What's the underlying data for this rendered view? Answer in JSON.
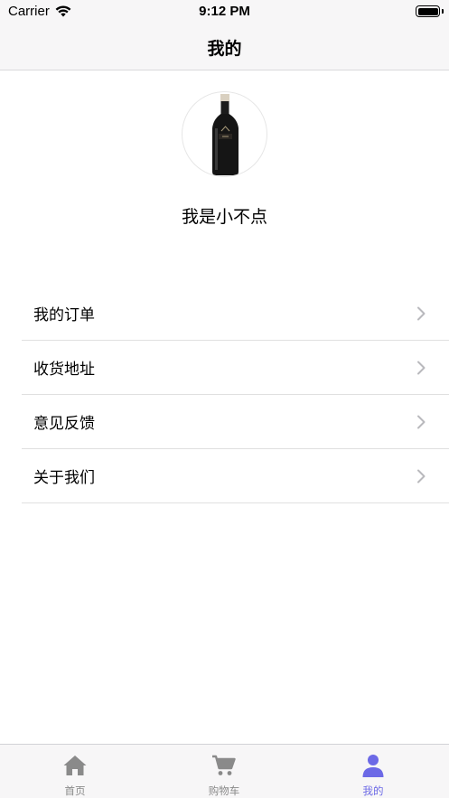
{
  "status_bar": {
    "carrier": "Carrier",
    "time": "9:12 PM"
  },
  "nav": {
    "title": "我的"
  },
  "profile": {
    "username": "我是小不点",
    "avatar_icon": "wine-bottle-avatar"
  },
  "menu": {
    "items": [
      {
        "label": "我的订单"
      },
      {
        "label": "收货地址"
      },
      {
        "label": "意见反馈"
      },
      {
        "label": "关于我们"
      }
    ]
  },
  "tab_bar": {
    "tabs": [
      {
        "label": "首页",
        "icon": "home-icon"
      },
      {
        "label": "购物车",
        "icon": "cart-icon"
      },
      {
        "label": "我的",
        "icon": "person-icon"
      }
    ],
    "active_index": 2
  },
  "colors": {
    "accent": "#6c69e6",
    "inactive_tab": "#8a8a8a",
    "bar_bg": "#f7f6f7"
  }
}
